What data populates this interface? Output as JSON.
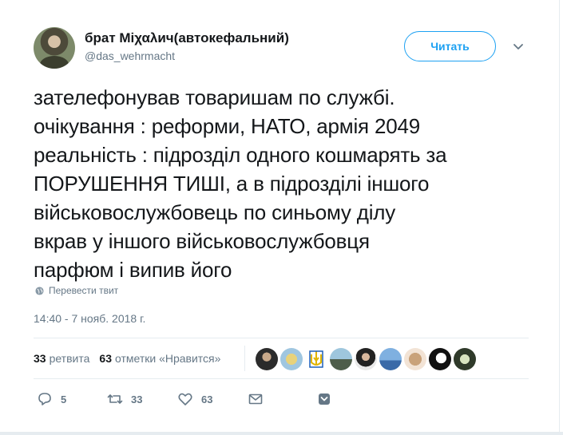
{
  "author": {
    "fullname": "брат Міχαλич(автокефальний)",
    "username": "@das_wehrmacht"
  },
  "follow_label": "Читать",
  "tweet_lines": [
    "зателефонував товаришам по службі.",
    "очікування : реформи, НАТО, армія 2049",
    "реальність : підрозділ одного кошмарять за",
    "ПОРУШЕННЯ ТИШІ, а в підрозділі іншого",
    "військовослужбовець по синьому ділу",
    "вкрав у іншого військовослужбовця",
    "парфюм і випив його"
  ],
  "translate_label": "Перевести твит",
  "timestamp": "14:40 - 7 нояб. 2018 г.",
  "stats": {
    "retweets_count": "33",
    "retweets_label": "ретвита",
    "likes_count": "63",
    "likes_label": "отметки «Нравится»"
  },
  "actions": {
    "reply_count": "5",
    "retweet_count": "33",
    "like_count": "63"
  },
  "colors": {
    "accent": "#1da1f2",
    "secondary_text": "#657786",
    "primary_text": "#14171a"
  },
  "icons": [
    "caret-down-icon",
    "globe-icon",
    "reply-icon",
    "retweet-icon",
    "heart-icon",
    "mail-icon",
    "bookmark-icon"
  ]
}
